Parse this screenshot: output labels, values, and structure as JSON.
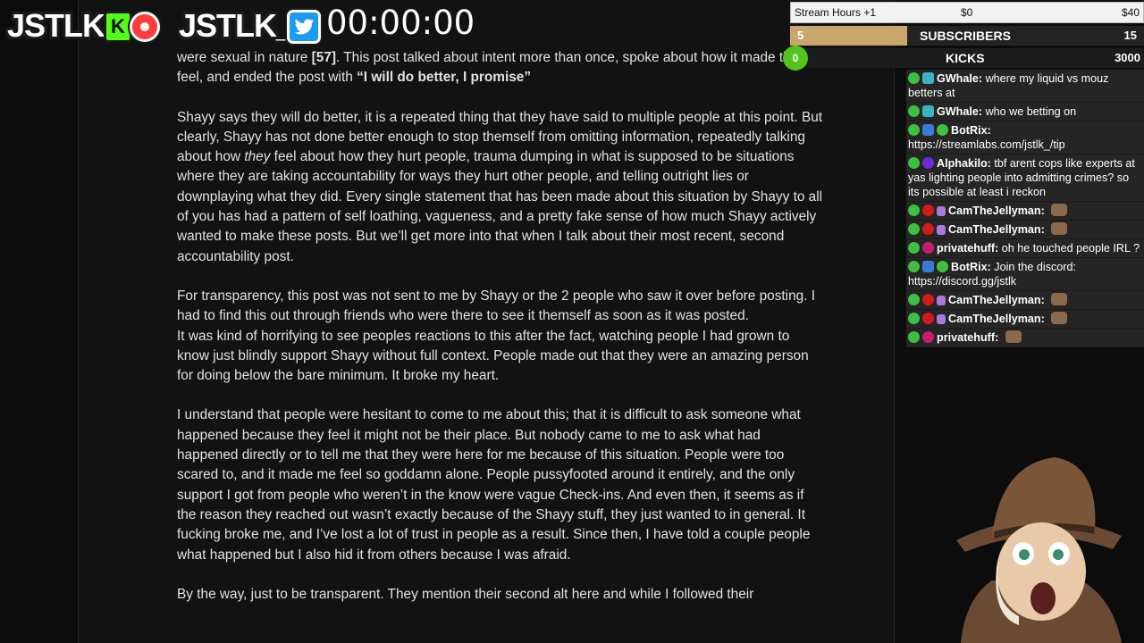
{
  "overlay": {
    "brand_left": "JSTLK",
    "kick_letter": "K",
    "brand_right": "JSTLK_",
    "timer": "00:00:00"
  },
  "goals": {
    "stream_hours": {
      "label": "Stream Hours +1",
      "min": "$0",
      "max": "$40"
    },
    "subscribers": {
      "current": "5",
      "label": "SUBSCRIBERS",
      "goal": "15",
      "progress": 0.33
    },
    "kicks": {
      "current": "0",
      "label": "KICKS",
      "goal": "3000"
    }
  },
  "document": {
    "p1_a": "were sexual in nature ",
    "p1_ref": "[57]",
    "p1_b": ". This post talked about intent more than once, spoke about how it made them feel, and ended the post with ",
    "p1_quote": "“I will do better, I promise”",
    "p2_a": "Shayy says they will do better, it is a repeated thing that they have said to multiple people at this point. But clearly, Shayy has not done better enough to stop themself from omitting information, repeatedly talking about how ",
    "p2_em": "they",
    "p2_b": " feel about how they hurt people, trauma dumping in what is supposed to be situations where they are taking accountability for ways they hurt other people, and telling outright lies or downplaying what they did. Every single statement that has been made about this situation by Shayy to all of you has had a pattern of self loathing, vagueness, and a pretty fake sense of how much Shayy actively wanted to make these posts. But we’ll get more into that when I talk about their most recent, second accountability post.",
    "p3": "For transparency, this post was not sent to me by Shayy or the 2 people who saw it over before posting. I had to find this out through friends who were there to see it themself as soon as it was posted.",
    "p4": "It was kind of horrifying to see peoples reactions to this after the fact, watching people I had grown to know just blindly support Shayy without full context. People made out that they were an amazing person for doing below the bare minimum. It broke my heart.",
    "p5": "I understand that people were hesitant to come to me about this; that it is difficult to ask someone what happened because they feel it might not be their place. But nobody came to me to ask what had happened directly or to tell me that they were here for me because of this situation. People were too scared to, and it made me feel so goddamn alone. People pussyfooted around it entirely, and the only support I got from people who weren’t in the know were vague Check-ins. And even then, it seems as if the reason they reached out wasn’t exactly because of the Shayy stuff, they just wanted to in general. It fucking broke me, and I’ve lost a lot of trust in people as a result. Since then, I have told a couple people what happened but I also hid it from others because I was afraid.",
    "p6": "By the way, just to be transparent. They mention their second alt here and while I followed their"
  },
  "chat": [
    {
      "user": "GWhale:",
      "text": "where my liquid vs mouz betters at",
      "badges": [
        "x-icon",
        "teal-badge-icon"
      ]
    },
    {
      "user": "GWhale:",
      "text": "who we betting on",
      "badges": [
        "x-icon",
        "teal-badge-icon"
      ]
    },
    {
      "user": "BotRix:",
      "text": "https://streamlabs.com/jstlk_/tip",
      "badges": [
        "x-icon",
        "blue-badge-icon",
        "verified-icon"
      ]
    },
    {
      "user": "Alphakilo:",
      "text": "tbf arent cops like experts at yas lighting people into admitting crimes? so its possible at least i reckon",
      "badges": [
        "x-icon",
        "purple-badge-icon"
      ]
    },
    {
      "user": "CamTheJellyman:",
      "text": "",
      "badges": [
        "x-icon",
        "red-badge-icon",
        "gem-icon"
      ],
      "emote": true
    },
    {
      "user": "CamTheJellyman:",
      "text": "",
      "badges": [
        "x-icon",
        "red-badge-icon",
        "gem-icon"
      ],
      "emote": true
    },
    {
      "user": "privatehuff:",
      "text": "oh he touched people IRL ?",
      "badges": [
        "x-icon",
        "pink-badge-icon"
      ]
    },
    {
      "user": "BotRix:",
      "text": "Join the discord: https://discord.gg/jstlk",
      "badges": [
        "x-icon",
        "blue-badge-icon",
        "verified-icon"
      ]
    },
    {
      "user": "CamTheJellyman:",
      "text": "",
      "badges": [
        "x-icon",
        "red-badge-icon",
        "gem-icon"
      ],
      "emote": true
    },
    {
      "user": "CamTheJellyman:",
      "text": "",
      "badges": [
        "x-icon",
        "red-badge-icon",
        "gem-icon"
      ],
      "emote": true
    },
    {
      "user": "privatehuff:",
      "text": "",
      "badges": [
        "x-icon",
        "pink-badge-icon"
      ],
      "emote": true
    }
  ],
  "colors": {
    "kick_green": "#53fc18",
    "rec_red": "#ff3b3b",
    "twitter_blue": "#1d9bf0",
    "sub_fill": "#c9a66b"
  }
}
